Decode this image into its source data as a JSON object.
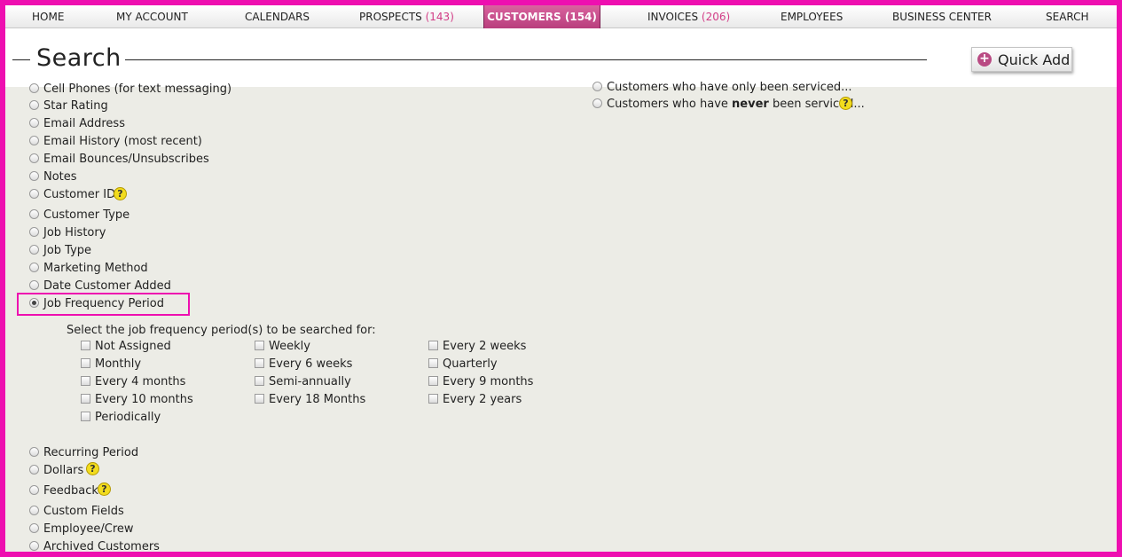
{
  "nav": {
    "items": [
      {
        "label": "HOME",
        "count": ""
      },
      {
        "label": "MY ACCOUNT",
        "count": ""
      },
      {
        "label": "CALENDARS",
        "count": ""
      },
      {
        "label": "PROSPECTS",
        "count": "(143)"
      },
      {
        "label": "CUSTOMERS",
        "count": "(154)"
      },
      {
        "label": "INVOICES",
        "count": "(206)"
      },
      {
        "label": "EMPLOYEES",
        "count": ""
      },
      {
        "label": "BUSINESS CENTER",
        "count": ""
      },
      {
        "label": "SEARCH",
        "count": ""
      }
    ],
    "active": "CUSTOMERS"
  },
  "header": {
    "title": "Search",
    "quick_add_label": "Quick Add"
  },
  "left_options": [
    "Cell Phones (for text messaging)",
    "Star Rating",
    "Email Address",
    "Email History (most recent)",
    "Email Bounces/Unsubscribes",
    "Notes",
    "Customer ID",
    "Customer Type",
    "Job History",
    "Job Type",
    "Marketing Method",
    "Date Customer Added",
    "Job Frequency Period",
    "Recurring Period",
    "Dollars",
    "Feedback",
    "Custom Fields",
    "Employee/Crew",
    "Archived Customers"
  ],
  "selected_option": "Job Frequency Period",
  "frequency": {
    "prompt": "Select the job frequency period(s) to be searched for:",
    "col1": [
      "Not Assigned",
      "Monthly",
      "Every 4 months",
      "Every 10 months",
      "Periodically"
    ],
    "col2": [
      "Weekly",
      "Every 6 weeks",
      "Semi-annually",
      "Every 18 Months"
    ],
    "col3": [
      "Every 2 weeks",
      "Quarterly",
      "Every 9 months",
      "Every 2 years"
    ]
  },
  "right_options": {
    "serviced_only": "Customers who have only been serviced...",
    "never_prefix": "Customers who have ",
    "never_bold": "never",
    "never_suffix": " been serviced..."
  },
  "help_glyph": "?",
  "plus_glyph": "+",
  "colors": {
    "accent": "#ee0fb0",
    "active_tab": "#c24f8c",
    "count": "#d23c86",
    "help": "#f2dc1e"
  }
}
